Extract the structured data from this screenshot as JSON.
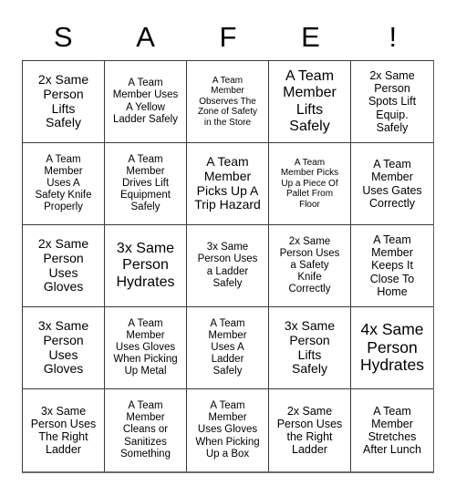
{
  "card": {
    "header_letters": [
      "S",
      "A",
      "F",
      "E",
      "!"
    ],
    "rows": [
      [
        {
          "text": "2x Same\nPerson\nLifts\nSafely",
          "size": "lg"
        },
        {
          "text": "A Team\nMember Uses\nA Yellow\nLadder Safely",
          "size": "sm"
        },
        {
          "text": "A Team\nMember\nObserves The\nZone of Safety\nin the Store",
          "size": "xs"
        },
        {
          "text": "A Team\nMember\nLifts\nSafely",
          "size": "xl"
        },
        {
          "text": "2x Same\nPerson\nSpots Lift\nEquip.\nSafely",
          "size": "md"
        }
      ],
      [
        {
          "text": "A Team\nMember\nUses A\nSafety Knife\nProperly",
          "size": "sm"
        },
        {
          "text": "A Team\nMember\nDrives Lift\nEquipment\nSafely",
          "size": "sm"
        },
        {
          "text": "A Team\nMember\nPicks Up A\nTrip Hazard",
          "size": "lg"
        },
        {
          "text": "A Team\nMember Picks\nUp a Piece Of\nPallet From\nFloor",
          "size": "xs"
        },
        {
          "text": "A Team\nMember\nUses Gates\nCorrectly",
          "size": "md"
        }
      ],
      [
        {
          "text": "2x Same\nPerson\nUses\nGloves",
          "size": "lg"
        },
        {
          "text": "3x Same\nPerson\nHydrates",
          "size": "xl"
        },
        {
          "text": "3x Same\nPerson Uses\na Ladder\nSafely",
          "size": "sm"
        },
        {
          "text": "2x Same\nPerson Uses\na Safety\nKnife\nCorrectly",
          "size": "sm"
        },
        {
          "text": "A Team\nMember\nKeeps It\nClose To\nHome",
          "size": "md"
        }
      ],
      [
        {
          "text": "3x Same\nPerson\nUses\nGloves",
          "size": "lg"
        },
        {
          "text": "A Team\nMember\nUses Gloves\nWhen Picking\nUp Metal",
          "size": "sm"
        },
        {
          "text": "A Team\nMember\nUses A\nLadder\nSafely",
          "size": "sm"
        },
        {
          "text": "3x Same\nPerson\nLifts\nSafely",
          "size": "lg"
        },
        {
          "text": "4x Same\nPerson\nHydrates",
          "size": "xxl"
        }
      ],
      [
        {
          "text": "3x Same\nPerson Uses\nThe Right\nLadder",
          "size": "md"
        },
        {
          "text": "A Team\nMember\nCleans or\nSanitizes\nSomething",
          "size": "sm"
        },
        {
          "text": "A Team\nMember\nUses Gloves\nWhen Picking\nUp a Box",
          "size": "sm"
        },
        {
          "text": "2x Same\nPerson Uses\nthe Right\nLadder",
          "size": "md"
        },
        {
          "text": "A Team\nMember\nStretches\nAfter Lunch",
          "size": "md"
        }
      ]
    ]
  }
}
